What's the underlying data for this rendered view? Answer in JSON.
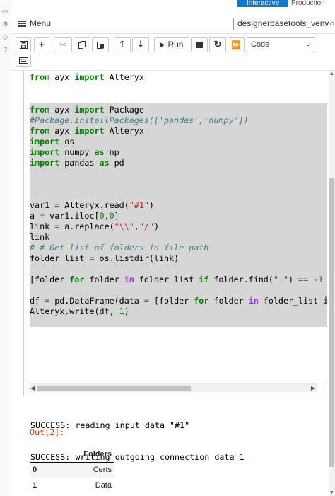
{
  "tabs": {
    "interactive": "Interactive",
    "production": "Production"
  },
  "menu": {
    "label": "Menu"
  },
  "kernel": {
    "name": "designerbasetools_venv"
  },
  "toolbar": {
    "run_label": "Run",
    "cell_type": "Code"
  },
  "code_top": [
    {
      "parts": [
        {
          "t": "from",
          "c": "kw"
        },
        {
          "t": " ayx ",
          "c": ""
        },
        {
          "t": "import",
          "c": "kw"
        },
        {
          "t": " Alteryx",
          "c": ""
        }
      ]
    }
  ],
  "code_main": [
    {
      "parts": [
        {
          "t": "from",
          "c": "kw"
        },
        {
          "t": " ayx ",
          "c": ""
        },
        {
          "t": "import",
          "c": "kw"
        },
        {
          "t": " Package",
          "c": ""
        }
      ]
    },
    {
      "parts": [
        {
          "t": "#Package.installPackages(['pandas','numpy'])",
          "c": "cm"
        }
      ]
    },
    {
      "parts": [
        {
          "t": "from",
          "c": "kw"
        },
        {
          "t": " ayx ",
          "c": ""
        },
        {
          "t": "import",
          "c": "kw"
        },
        {
          "t": " Alteryx",
          "c": ""
        }
      ]
    },
    {
      "parts": [
        {
          "t": "import",
          "c": "kw"
        },
        {
          "t": " os",
          "c": ""
        }
      ]
    },
    {
      "parts": [
        {
          "t": "import",
          "c": "kw"
        },
        {
          "t": " numpy ",
          "c": ""
        },
        {
          "t": "as",
          "c": "kw"
        },
        {
          "t": " np",
          "c": ""
        }
      ]
    },
    {
      "parts": [
        {
          "t": "import",
          "c": "kw"
        },
        {
          "t": " pandas ",
          "c": ""
        },
        {
          "t": "as",
          "c": "kw"
        },
        {
          "t": " pd",
          "c": ""
        }
      ]
    },
    {
      "parts": []
    },
    {
      "parts": []
    },
    {
      "parts": []
    },
    {
      "parts": [
        {
          "t": "var1 ",
          "c": ""
        },
        {
          "t": "=",
          "c": "op2"
        },
        {
          "t": " Alteryx.read(",
          "c": ""
        },
        {
          "t": "\"#1\"",
          "c": "st"
        },
        {
          "t": ")",
          "c": ""
        }
      ]
    },
    {
      "parts": [
        {
          "t": "a ",
          "c": ""
        },
        {
          "t": "=",
          "c": "op2"
        },
        {
          "t": " var1.iloc[",
          "c": ""
        },
        {
          "t": "0",
          "c": "num"
        },
        {
          "t": ",",
          "c": ""
        },
        {
          "t": "0",
          "c": "num"
        },
        {
          "t": "]",
          "c": ""
        }
      ]
    },
    {
      "parts": [
        {
          "t": "link ",
          "c": ""
        },
        {
          "t": "=",
          "c": "op2"
        },
        {
          "t": " a.replace(",
          "c": ""
        },
        {
          "t": "\"\\\\\"",
          "c": "st"
        },
        {
          "t": ",",
          "c": ""
        },
        {
          "t": "\"/\"",
          "c": "st"
        },
        {
          "t": ")",
          "c": ""
        }
      ]
    },
    {
      "parts": [
        {
          "t": "link",
          "c": ""
        }
      ]
    },
    {
      "parts": [
        {
          "t": "# # Get list of folders in file path",
          "c": "cm"
        }
      ]
    },
    {
      "parts": [
        {
          "t": "folder_list ",
          "c": ""
        },
        {
          "t": "=",
          "c": "op2"
        },
        {
          "t": " os.listdir(link)",
          "c": ""
        }
      ]
    },
    {
      "parts": []
    },
    {
      "parts": [
        {
          "t": "[folder ",
          "c": ""
        },
        {
          "t": "for",
          "c": "kw"
        },
        {
          "t": " folder ",
          "c": ""
        },
        {
          "t": "in",
          "c": "op"
        },
        {
          "t": " folder_list ",
          "c": ""
        },
        {
          "t": "if",
          "c": "kw"
        },
        {
          "t": " folder.find(",
          "c": ""
        },
        {
          "t": "\".\"",
          "c": "st"
        },
        {
          "t": ") ",
          "c": ""
        },
        {
          "t": "==",
          "c": "op2"
        },
        {
          "t": " ",
          "c": ""
        },
        {
          "t": "-1",
          "c": "num"
        }
      ]
    },
    {
      "parts": []
    },
    {
      "parts": [
        {
          "t": "df ",
          "c": ""
        },
        {
          "t": "=",
          "c": "op2"
        },
        {
          "t": " pd.DataFrame(data ",
          "c": ""
        },
        {
          "t": "=",
          "c": "op2"
        },
        {
          "t": " [folder ",
          "c": ""
        },
        {
          "t": "for",
          "c": "kw"
        },
        {
          "t": " folder ",
          "c": ""
        },
        {
          "t": "in",
          "c": "op"
        },
        {
          "t": " folder_list ",
          "c": ""
        },
        {
          "t": "i",
          "c": "kw"
        }
      ]
    },
    {
      "parts": [
        {
          "t": "Alteryx.write(df, ",
          "c": ""
        },
        {
          "t": "1",
          "c": "num"
        },
        {
          "t": ")",
          "c": ""
        }
      ]
    }
  ],
  "output": {
    "stream": [
      "SUCCESS: reading input data \"#1\"",
      "SUCCESS: writing outgoing connection data 1"
    ],
    "prompt": "Out[2]:",
    "table": {
      "header": "Folders",
      "rows": [
        {
          "index": "0",
          "value": "Certs"
        },
        {
          "index": "1",
          "value": "Data"
        }
      ]
    }
  }
}
